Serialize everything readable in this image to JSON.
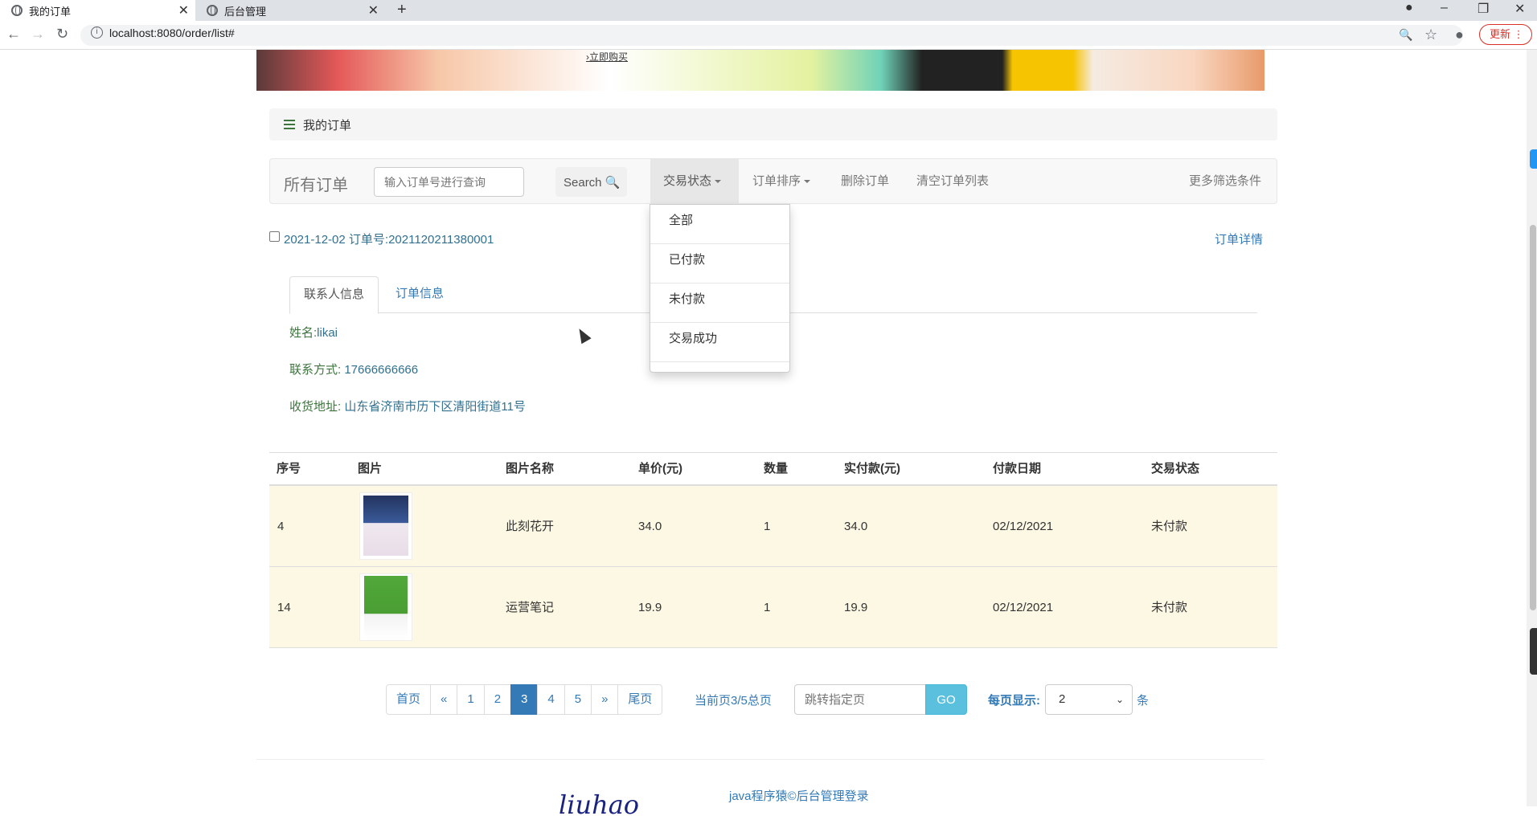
{
  "browser": {
    "tabs": [
      {
        "title": "我的订单"
      },
      {
        "title": "后台管理"
      }
    ],
    "new_tab": "+",
    "url": "localhost:8080/order/list#",
    "update_label": "更新"
  },
  "banner": {
    "buy_label": "›立即购买"
  },
  "breadcrumb": {
    "label": "我的订单"
  },
  "toolbar": {
    "brand": "所有订单",
    "search_placeholder": "输入订单号进行查询",
    "search_label": "Search",
    "status_label": "交易状态",
    "sort_label": "订单排序",
    "delete_label": "删除订单",
    "clear_label": "清空订单列表",
    "more_label": "更多筛选条件"
  },
  "status_dropdown": {
    "options": [
      "全部",
      "已付款",
      "未付款",
      "交易成功"
    ]
  },
  "order": {
    "header": "2021-12-02 订单号:2021120211380001",
    "detail_link": "订单详情",
    "tabs": [
      "联系人信息",
      "订单信息"
    ],
    "name_label": "姓名:",
    "name": "likai",
    "phone_label": "联系方式: ",
    "phone": "17666666666",
    "address_label": "收货地址: ",
    "address": "山东省济南市历下区清阳街道11号"
  },
  "table": {
    "columns": [
      "序号",
      "图片",
      "图片名称",
      "单价(元)",
      "数量",
      "实付款(元)",
      "付款日期",
      "交易状态"
    ],
    "rows": [
      {
        "id": "4",
        "name": "此刻花开",
        "price": "34.0",
        "qty": "1",
        "paid": "34.0",
        "date": "02/12/2021",
        "status": "未付款"
      },
      {
        "id": "14",
        "name": "运营笔记",
        "price": "19.9",
        "qty": "1",
        "paid": "19.9",
        "date": "02/12/2021",
        "status": "未付款"
      }
    ]
  },
  "pagination": {
    "first": "首页",
    "prev": "«",
    "pages": [
      "1",
      "2",
      "3",
      "4",
      "5"
    ],
    "current": "3",
    "next": "»",
    "last": "尾页",
    "info": "当前页3/5总页",
    "jump_placeholder": "跳转指定页",
    "go_label": "GO",
    "per_page_label": "每页显示:",
    "per_page_value": "2",
    "unit": "条"
  },
  "footer": {
    "link": "java程序猿©后台管理登录",
    "logo": "liuhao"
  },
  "colors": {
    "link": "#337ab7",
    "row_highlight": "#fcf8e3",
    "active_page": "#337ab7",
    "go_button": "#5bc0de"
  }
}
